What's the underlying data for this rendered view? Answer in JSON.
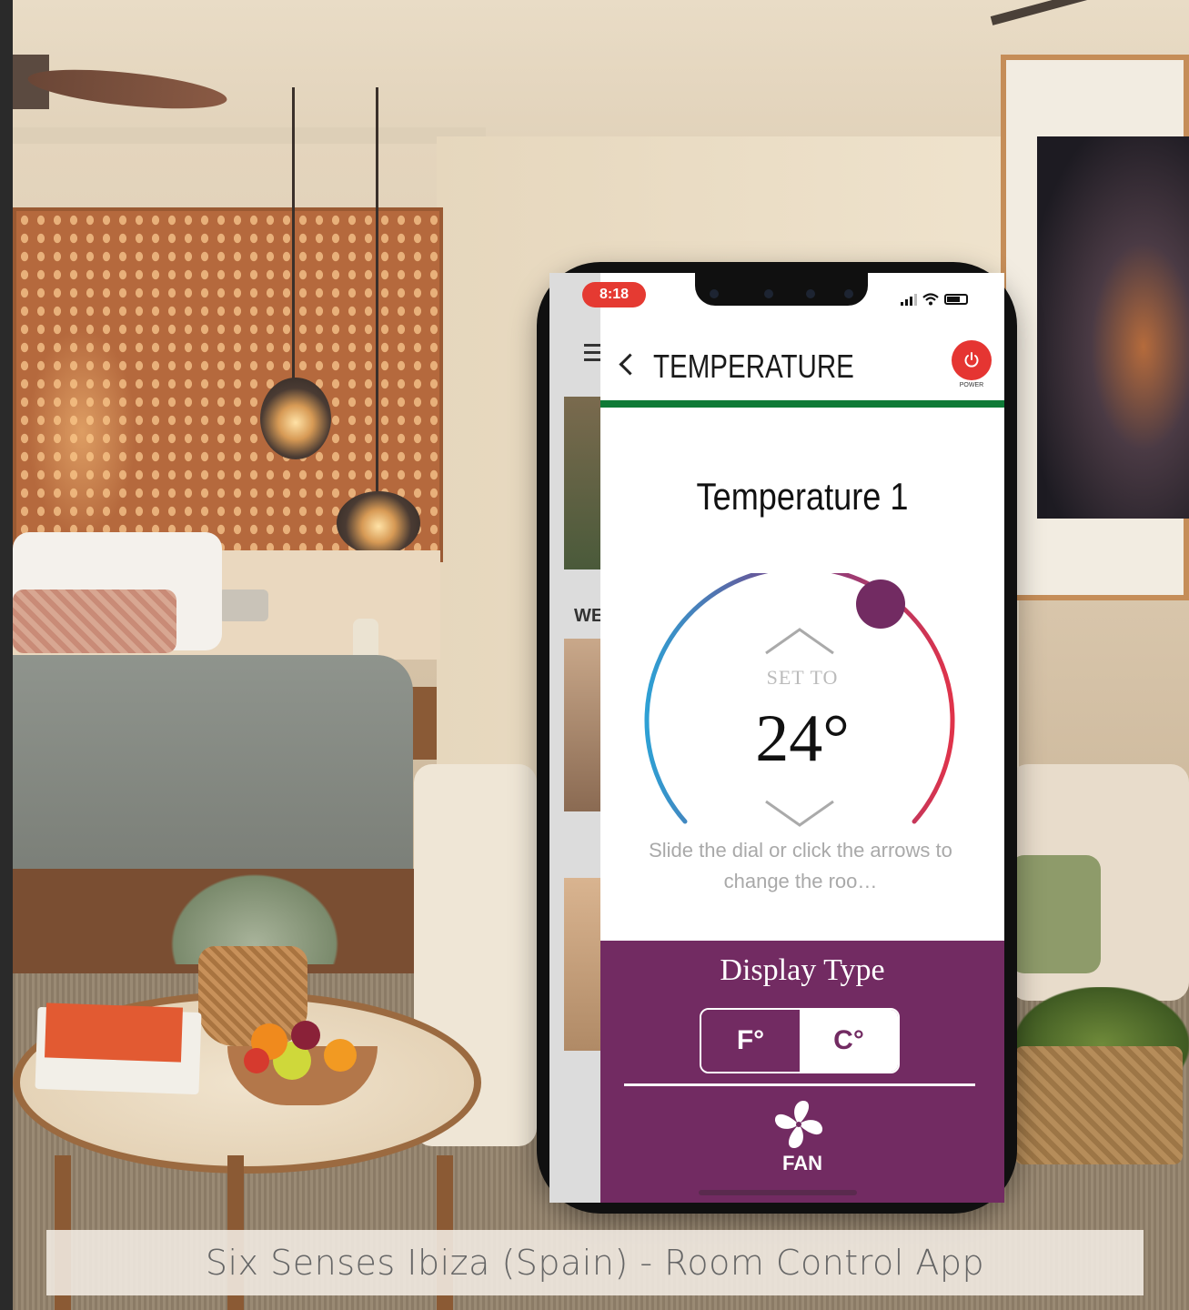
{
  "caption": "Six Senses Ibiza (Spain) - Room Control App",
  "status_bar": {
    "time": "8:18"
  },
  "background_app": {
    "visible_text": "WE"
  },
  "header": {
    "title": "TEMPERATURE",
    "power_label": "POWER"
  },
  "thermostat": {
    "name": "Temperature 1",
    "set_label": "SET TO",
    "value": "24°",
    "hint": "Slide the dial or click the arrows to change the roo…"
  },
  "display_type": {
    "title": "Display Type",
    "options": [
      "F°",
      "C°"
    ],
    "selected": "C°"
  },
  "fan": {
    "label": "FAN"
  },
  "colors": {
    "accent_purple": "#722b62",
    "power_red": "#e53532",
    "header_rule_green": "#0f7a36",
    "dial_cool": "#2ea0d4",
    "dial_warm": "#e0334a"
  }
}
